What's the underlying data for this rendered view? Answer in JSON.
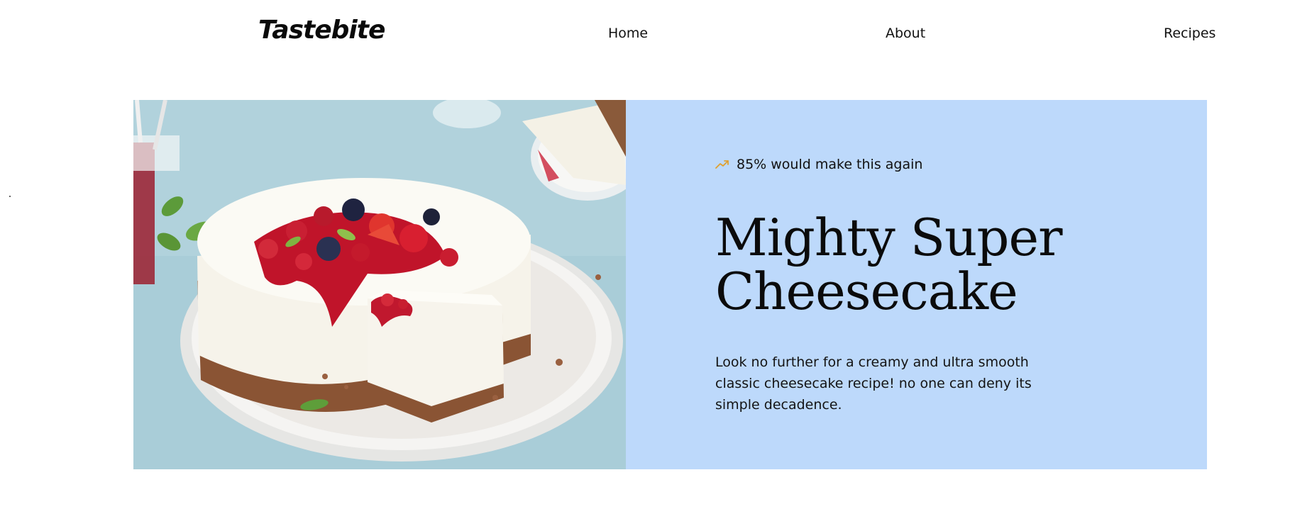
{
  "nav": {
    "brand": "Tastebite",
    "links": [
      {
        "label": "Home"
      },
      {
        "label": "About"
      },
      {
        "label": "Recipes"
      }
    ]
  },
  "hero": {
    "stat_icon": "trending-up-icon",
    "stat_text": "85% would make this again",
    "title": "Mighty Super Cheesecake",
    "description": "Look no further for a creamy and ultra smooth classic cheesecake recipe! no one can deny its simple decadence.",
    "image_subject": "cheesecake-with-berries-photo",
    "panel_color": "#bdd9fb",
    "stat_icon_color": "#e0a030"
  }
}
